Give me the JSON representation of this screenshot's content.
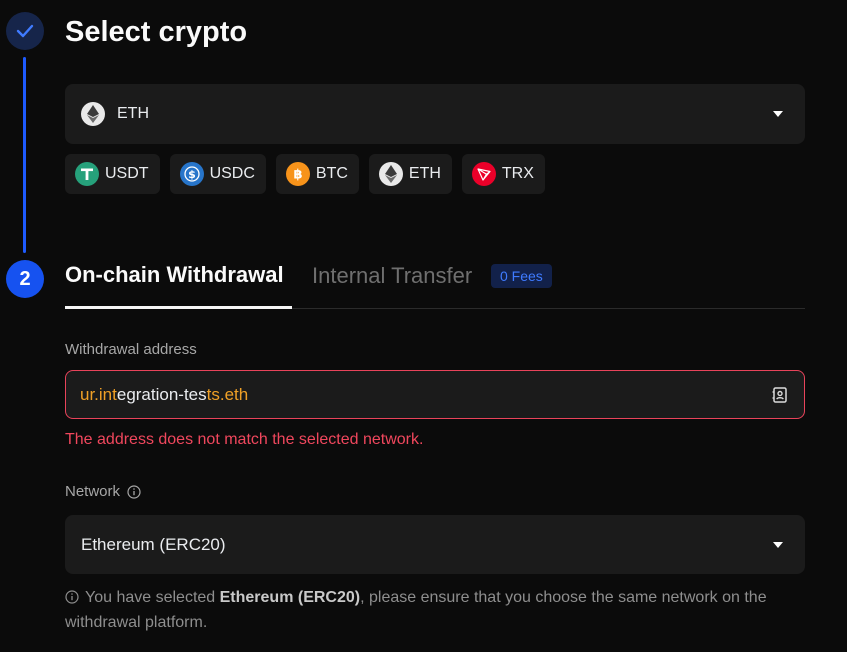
{
  "step_one": {
    "icon": "check-icon"
  },
  "step_two": {
    "number": "2"
  },
  "title": "Select crypto",
  "crypto_select": {
    "selected": "ETH",
    "icon": "ethereum-icon"
  },
  "quick_coins": [
    {
      "label": "USDT",
      "icon": "tether-icon",
      "color": "#26a17b"
    },
    {
      "label": "USDC",
      "icon": "usdc-icon",
      "color": "#2775ca"
    },
    {
      "label": "BTC",
      "icon": "bitcoin-icon",
      "color": "#f7931a"
    },
    {
      "label": "ETH",
      "icon": "ethereum-icon",
      "color": "#ffffff"
    },
    {
      "label": "TRX",
      "icon": "tron-icon",
      "color": "#eb0029"
    }
  ],
  "tabs": {
    "active": "On-chain Withdrawal",
    "inactive": "Internal Transfer",
    "badge": "0 Fees"
  },
  "address": {
    "label": "Withdrawal address",
    "value_parts": [
      "ur.int",
      "egration-tes",
      "ts.eth"
    ],
    "error": "The address does not match the selected network."
  },
  "network": {
    "label": "Network",
    "selected": "Ethereum (ERC20)",
    "notice_before": "You have selected ",
    "notice_bold": "Ethereum (ERC20)",
    "notice_after": ", please ensure that you choose the same network on the withdrawal platform."
  },
  "colors": {
    "accent": "#1652f0",
    "error": "#f0475d",
    "highlight": "#f0a026"
  }
}
